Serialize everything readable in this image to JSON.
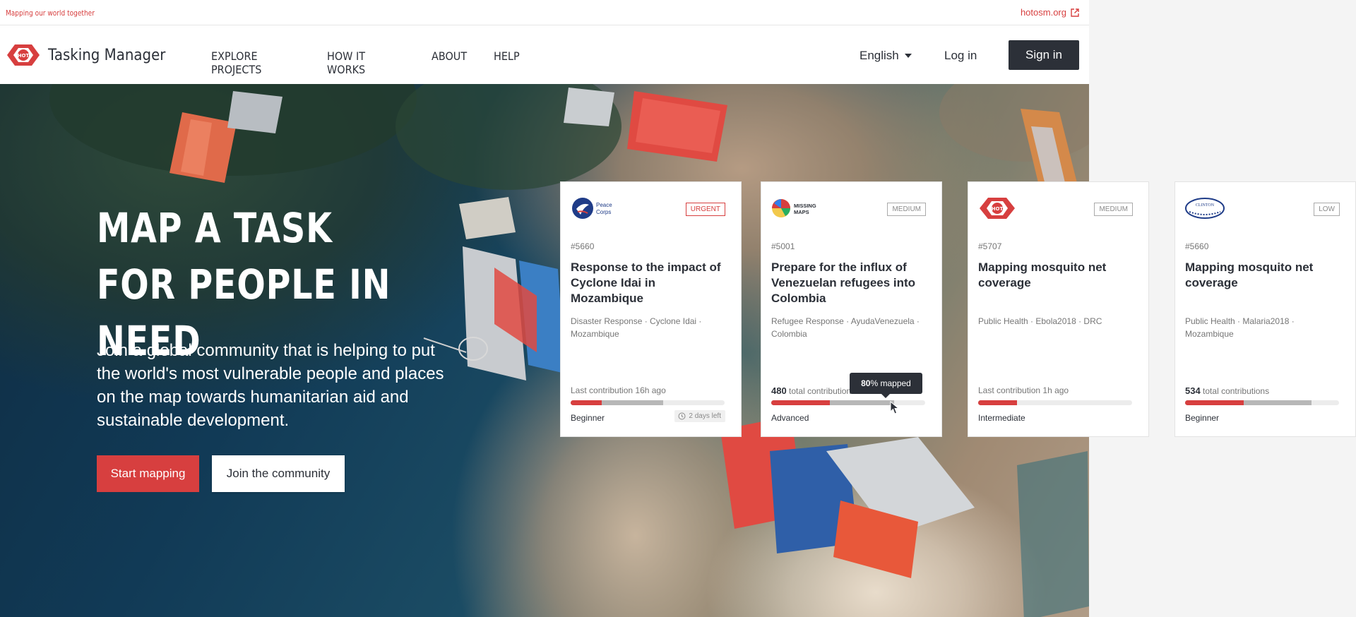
{
  "topbar": {
    "tagline": "Mapping our world together",
    "external_link": "hotosm.org"
  },
  "navbar": {
    "brand": "Tasking Manager",
    "logo_text": "HOT",
    "links": [
      "EXPLORE PROJECTS",
      "HOW IT WORKS",
      "ABOUT",
      "HELP"
    ],
    "language": "English",
    "login_label": "Log in",
    "signin_label": "Sign in"
  },
  "hero": {
    "title": "MAP A TASK FOR PEOPLE IN NEED",
    "subtitle": "Join a global community that is helping to put the world's most vulnerable people and places on the map towards humanitarian aid and sustainable development.",
    "primary_button": "Start mapping",
    "secondary_button": "Join the community"
  },
  "cards": [
    {
      "org_logo": "peace-corps-logo",
      "org_text_1": "Peace",
      "org_text_2": "Corps",
      "priority": "URGENT",
      "id": "#5660",
      "title": "Response to the impact of Cyclone Idai in Mozambique",
      "tags": "Disaster Response · Cyclone Idai · Mozambique",
      "contribution": "Last contribution 16h ago",
      "mapped_percent": 20,
      "validated_percent": 60,
      "level": "Beginner",
      "time_left": "2 days left"
    },
    {
      "org_logo": "missing-maps-logo",
      "org_text_1": "MISSING",
      "org_text_2": "MAPS",
      "priority": "MEDIUM",
      "id": "#5001",
      "title": "Prepare for the influx of Venezuelan refugees into Colombia",
      "tags": "Refugee Response · AyudaVenezuela · Colombia",
      "contribution_count": "480",
      "contribution": "total contributions",
      "mapped_percent": 38,
      "validated_percent": 80,
      "level": "Advanced"
    },
    {
      "org_logo": "hot-logo",
      "org_text_1": "HOT",
      "priority": "MEDIUM",
      "id": "#5707",
      "title": "Mapping mosquito net coverage",
      "tags": "Public Health · Ebola2018 · DRC",
      "contribution": "Last contribution 1h ago",
      "mapped_percent": 25,
      "validated_percent": 25,
      "level": "Intermediate"
    },
    {
      "org_logo": "clinton-foundation-logo",
      "org_text_1": "CLINTON",
      "priority": "LOW",
      "id": "#5660",
      "title": "Mapping mosquito net coverage",
      "tags": "Public Health · Malaria2018 · Mozambique",
      "contribution_count": "534",
      "contribution": "total contributions",
      "mapped_percent": 38,
      "validated_percent": 82,
      "level": "Beginner"
    }
  ],
  "tooltip": {
    "value": "80",
    "suffix": "% mapped"
  },
  "colors": {
    "brand_red": "#d73f3f",
    "dark": "#2c3038"
  }
}
